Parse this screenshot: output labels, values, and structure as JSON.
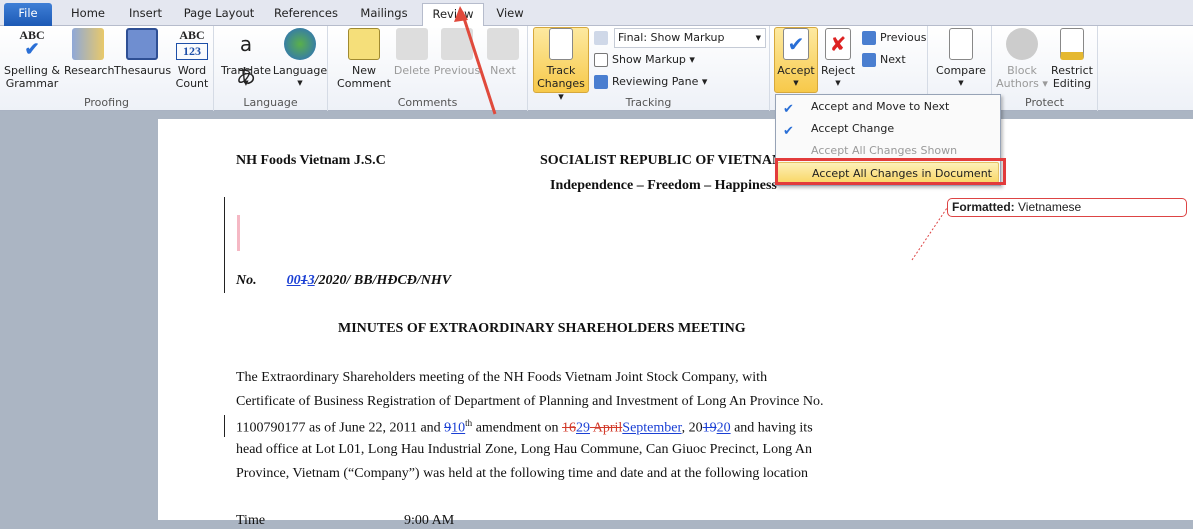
{
  "tabs": [
    "File",
    "Home",
    "Insert",
    "Page Layout",
    "References",
    "Mailings",
    "Review",
    "View"
  ],
  "active_tab": "Review",
  "ribbon": {
    "proofing": {
      "label": "Proofing",
      "buttons": [
        "Spelling & Grammar",
        "Research",
        "Thesaurus",
        "Word Count"
      ]
    },
    "language": {
      "label": "Language",
      "buttons": [
        "Translate",
        "Language"
      ]
    },
    "comments": {
      "label": "Comments",
      "buttons": [
        "New Comment",
        "Delete",
        "Previous",
        "Next"
      ]
    },
    "tracking": {
      "label": "Tracking",
      "track_changes": "Track Changes",
      "markup_select": "Final: Show Markup",
      "show_markup": "Show Markup",
      "reviewing_pane": "Reviewing Pane"
    },
    "changes": {
      "accept": "Accept",
      "reject": "Reject",
      "previous": "Previous",
      "next": "Next"
    },
    "compare": {
      "compare": "Compare"
    },
    "protect": {
      "label": "Protect",
      "block_authors": "Block Authors",
      "restrict_editing": "Restrict Editing"
    }
  },
  "accept_menu": [
    "Accept and Move to Next",
    "Accept Change",
    "Accept All Changes Shown",
    "Accept All Changes in Document"
  ],
  "comment": {
    "label": "Formatted:",
    "value": "Vietnamese"
  },
  "document": {
    "company": "NH Foods Vietnam J.S.C",
    "republic": "SOCIALIST  REPUBLIC  OF  VIETNAM",
    "motto": "Independence  – Freedom  – Happiness",
    "no_label": "No.",
    "no_ins1": "00",
    "no_del": "1",
    "no_ins2": "3",
    "no_rest": "/2020/ BB/HĐCĐ/NHV",
    "title": "MINUTES OF EXTRAORDINARY  SHAREHOLDERS  MEETING",
    "p1": "The Extraordinary  Shareholders  meeting  of the NH Foods Vietnam  Joint  Stock Company,  with",
    "p2": "Certificate of Business Registration of Department of Planning and Investment of Long An Province No.",
    "p3a": "1100790177 as of June  22, 2011 and ",
    "p3_del1": "9",
    "p3_ins1": "10",
    "p3_sup": "th",
    "p3b": " amendment  on ",
    "p3_del2": "16",
    "p3_ins2": "29",
    "p3_del3": " April",
    "p3_ins3": "September",
    "p3c": ",  20",
    "p3_del4": "19",
    "p3_ins4": "20",
    "p3d": " and having  its",
    "p4": "head office  at Lot L01, Long Hau Industrial  Zone, Long Hau Commune,  Can Giuoc  Precinct,  Long  An",
    "p5": "Province,  Vietnam  (“Company”)  was held  at the following  time  and  date and at the following  location",
    "time_label": "Time",
    "time_value": "9:00 AM"
  }
}
